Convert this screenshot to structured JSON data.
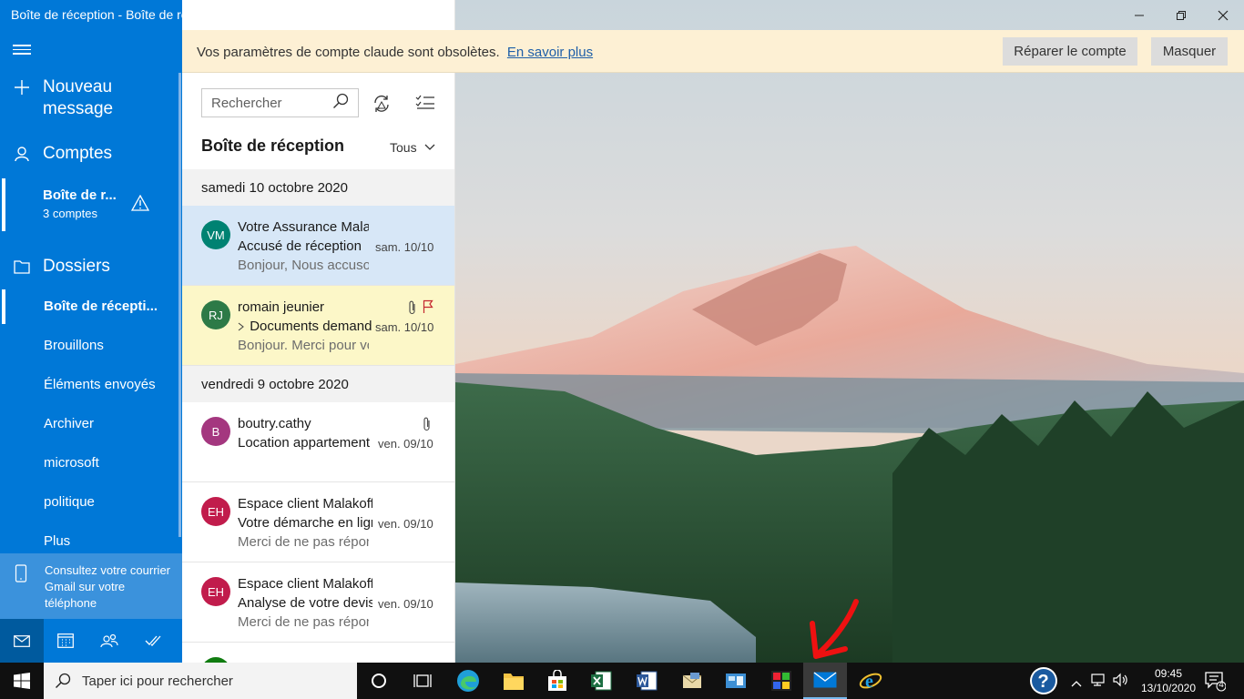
{
  "window": {
    "title": "Boîte de réception - Boîte de réception"
  },
  "nav": {
    "new_message": "Nouveau message",
    "accounts": "Comptes",
    "account_name": "Boîte de r...",
    "account_sub": "3 comptes",
    "folders_label": "Dossiers",
    "folders": [
      "Boîte de récepti...",
      "Brouillons",
      "Éléments envoyés",
      "Archiver",
      "microsoft",
      "politique",
      "Plus"
    ],
    "promo": "Consultez votre courrier Gmail sur votre téléphone"
  },
  "list": {
    "search_placeholder": "Rechercher",
    "title": "Boîte de réception",
    "filter": "Tous",
    "groups": [
      {
        "date": "samedi 10 octobre 2020"
      },
      {
        "date": "vendredi 9 octobre 2020"
      }
    ],
    "messages": [
      {
        "initials": "VM",
        "color": "#008272",
        "sender": "Votre Assurance Malakoff",
        "subject": "Accusé de réception",
        "preview": "Bonjour, Nous accusons",
        "date": "sam. 10/10",
        "bg": "#d7e7f7"
      },
      {
        "initials": "RJ",
        "color": "#2d7a47",
        "sender": "romain jeunier",
        "subject": "Documents demandés",
        "preview": "Bonjour. Merci pour votre",
        "date": "sam. 10/10",
        "bg": "#fcf7c8"
      },
      {
        "initials": "B",
        "color": "#a4377f",
        "sender": "boutry.cathy",
        "subject": "Location appartement",
        "preview": "",
        "date": "ven. 09/10",
        "bg": "#ffffff"
      },
      {
        "initials": "EH",
        "color": "#c11c4c",
        "sender": "Espace client Malakoff",
        "subject": "Votre démarche en ligne",
        "preview": "Merci de ne pas répondre",
        "date": "ven. 09/10",
        "bg": "#ffffff"
      },
      {
        "initials": "EH",
        "color": "#c11c4c",
        "sender": "Espace client Malakoff",
        "subject": "Analyse de votre devis",
        "preview": "Merci de ne pas répondre",
        "date": "ven. 09/10",
        "bg": "#ffffff"
      }
    ]
  },
  "banner": {
    "text": "Vos paramètres de compte claude sont obsolètes.",
    "link": "En savoir plus",
    "repair": "Réparer le compte",
    "hide": "Masquer"
  },
  "taskbar": {
    "search_placeholder": "Taper ici pour rechercher",
    "time": "09:45",
    "date": "13/10/2020",
    "notifications": "4"
  },
  "colors": {
    "nav_bg": "#0078d7",
    "banner_bg": "#fdf0d4",
    "accent": "#0078d7"
  }
}
